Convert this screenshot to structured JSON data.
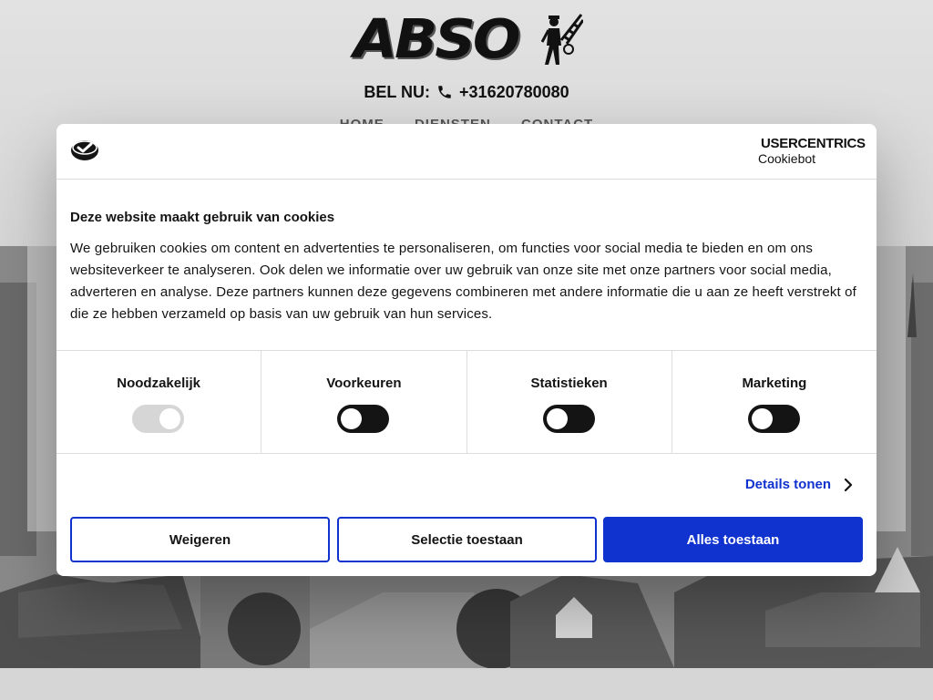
{
  "site": {
    "logo_text": "ABSO",
    "phone_prefix": "BEL NU:",
    "phone_number": "+31620780080",
    "nav": [
      "HOME",
      "DIENSTEN",
      "CONTACT"
    ]
  },
  "cookie_dialog": {
    "brand_name": "USERCENTRICS",
    "brand_sub": "Cookiebot",
    "title": "Deze website maakt gebruik van cookies",
    "text": "We gebruiken cookies om content en advertenties te personaliseren, om functies voor social media te bieden en om ons websiteverkeer te analyseren. Ook delen we informatie over uw gebruik van onze site met onze partners voor social media, adverteren en analyse. Deze partners kunnen deze gegevens combineren met andere informatie die u aan ze heeft verstrekt of die ze hebben verzameld op basis van uw gebruik van hun services.",
    "categories": [
      {
        "label": "Noodzakelijk",
        "checked": true,
        "disabled": true
      },
      {
        "label": "Voorkeuren",
        "checked": false,
        "disabled": false
      },
      {
        "label": "Statistieken",
        "checked": false,
        "disabled": false
      },
      {
        "label": "Marketing",
        "checked": false,
        "disabled": false
      }
    ],
    "details_label": "Details tonen",
    "buttons": {
      "deny": "Weigeren",
      "selection": "Selectie toestaan",
      "allow_all": "Alles toestaan"
    }
  },
  "colors": {
    "accent": "#1032cf",
    "toggle_off": "#141414",
    "toggle_disabled": "#d6d6d6"
  }
}
